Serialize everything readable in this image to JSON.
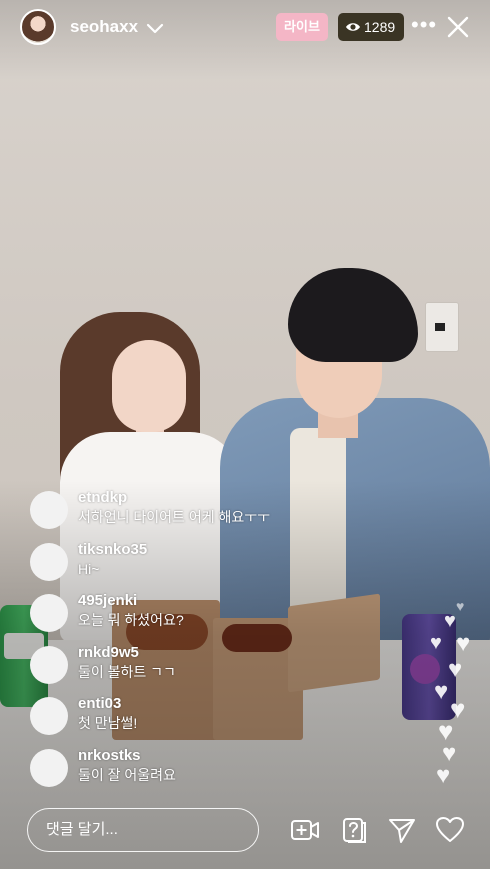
{
  "header": {
    "username": "seohaxx",
    "live_label": "라이브",
    "viewer_count": "1289"
  },
  "comments": [
    {
      "user": "etndkp",
      "text": "서하언니 다이어트 어케 해요ㅜㅜ"
    },
    {
      "user": "tiksnko35",
      "text": "Hi~"
    },
    {
      "user": "495jenki",
      "text": "오늘 뭐 하셨어요?"
    },
    {
      "user": "rnkd9w5",
      "text": "둘이 볼하트 ㄱㄱ"
    },
    {
      "user": "enti03",
      "text": "첫 만남썰!"
    },
    {
      "user": "nrkostks",
      "text": "둘이 잘 어울려요"
    }
  ],
  "footer": {
    "comment_placeholder": "댓글 달기..."
  },
  "icons": [
    "chevron-down-icon",
    "eye-icon",
    "more-icon",
    "close-icon",
    "add-video-icon",
    "question-icon",
    "send-icon",
    "heart-icon"
  ],
  "colors": {
    "live_badge": "#f4b6c6",
    "viewer_badge": "#3a3424"
  }
}
